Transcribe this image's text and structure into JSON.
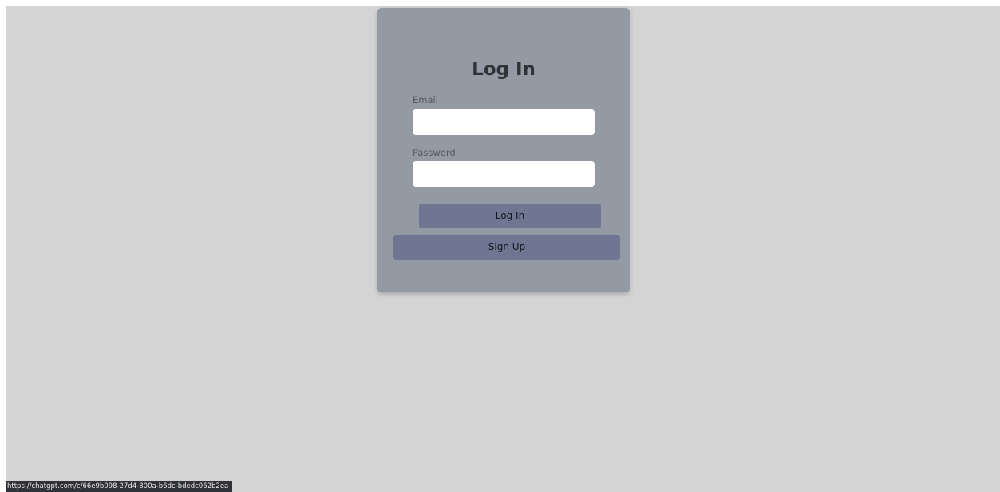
{
  "login": {
    "title": "Log In",
    "email_label": "Email",
    "email_value": "",
    "email_placeholder": "",
    "password_label": "Password",
    "password_value": "",
    "password_placeholder": "",
    "login_button": "Log In",
    "signup_button": "Sign Up"
  },
  "status_bar": {
    "url": "https://chatgpt.com/c/66e9b098-27d4-800a-b6dc-bdedc062b2ea"
  },
  "colors": {
    "page_background": "#d4d4d4",
    "card_background": "#939aa3",
    "button_background": "#6e7692",
    "input_background": "#ffffff"
  }
}
